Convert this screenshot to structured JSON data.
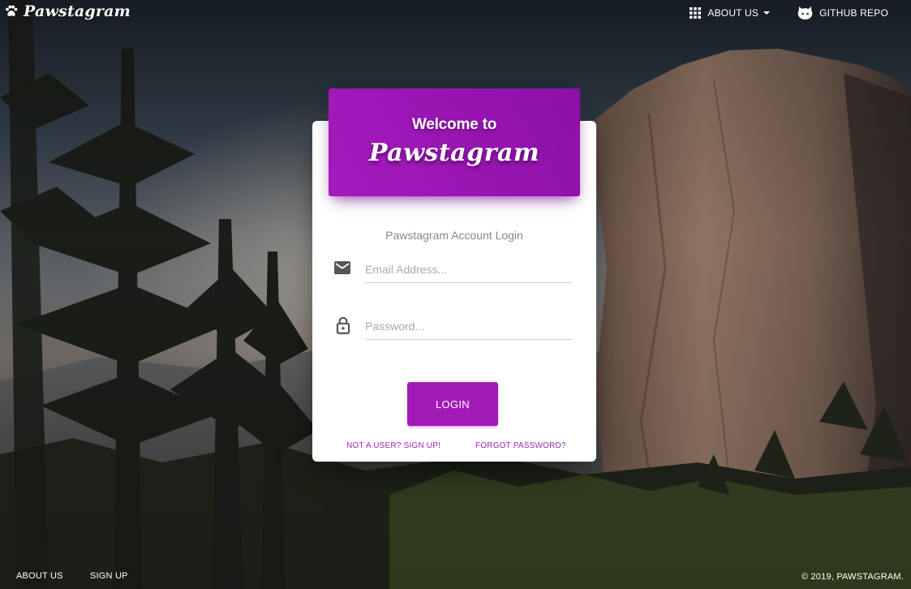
{
  "navbar": {
    "brand": "Pawstagram",
    "about_label": "ABOUT US",
    "github_label": "GITHUB REPO"
  },
  "card": {
    "welcome": "Welcome to",
    "brand": "Pawstagram",
    "login_title": "Pawstagram Account Login",
    "email_placeholder": "Email Address...",
    "email_value": "",
    "password_placeholder": "Password...",
    "password_value": "",
    "login_button": "LOGIN",
    "signup_link": "NOT A USER? SIGN UP!",
    "forgot_link": "FORGOT PASSWORD?"
  },
  "footer": {
    "about_label": "ABOUT US",
    "signup_label": "SIGN UP",
    "copyright": "© 2019, PAWSTAGRAM."
  },
  "colors": {
    "accent": "#9c27b0",
    "button": "#a31ab8",
    "header_gradient_start": "#a51bbd",
    "header_gradient_end": "#8c10a8"
  },
  "icons": {
    "brand": "paw-icon",
    "about": "apps-grid-icon",
    "github": "github-icon",
    "email": "email-icon",
    "password": "lock-icon"
  }
}
